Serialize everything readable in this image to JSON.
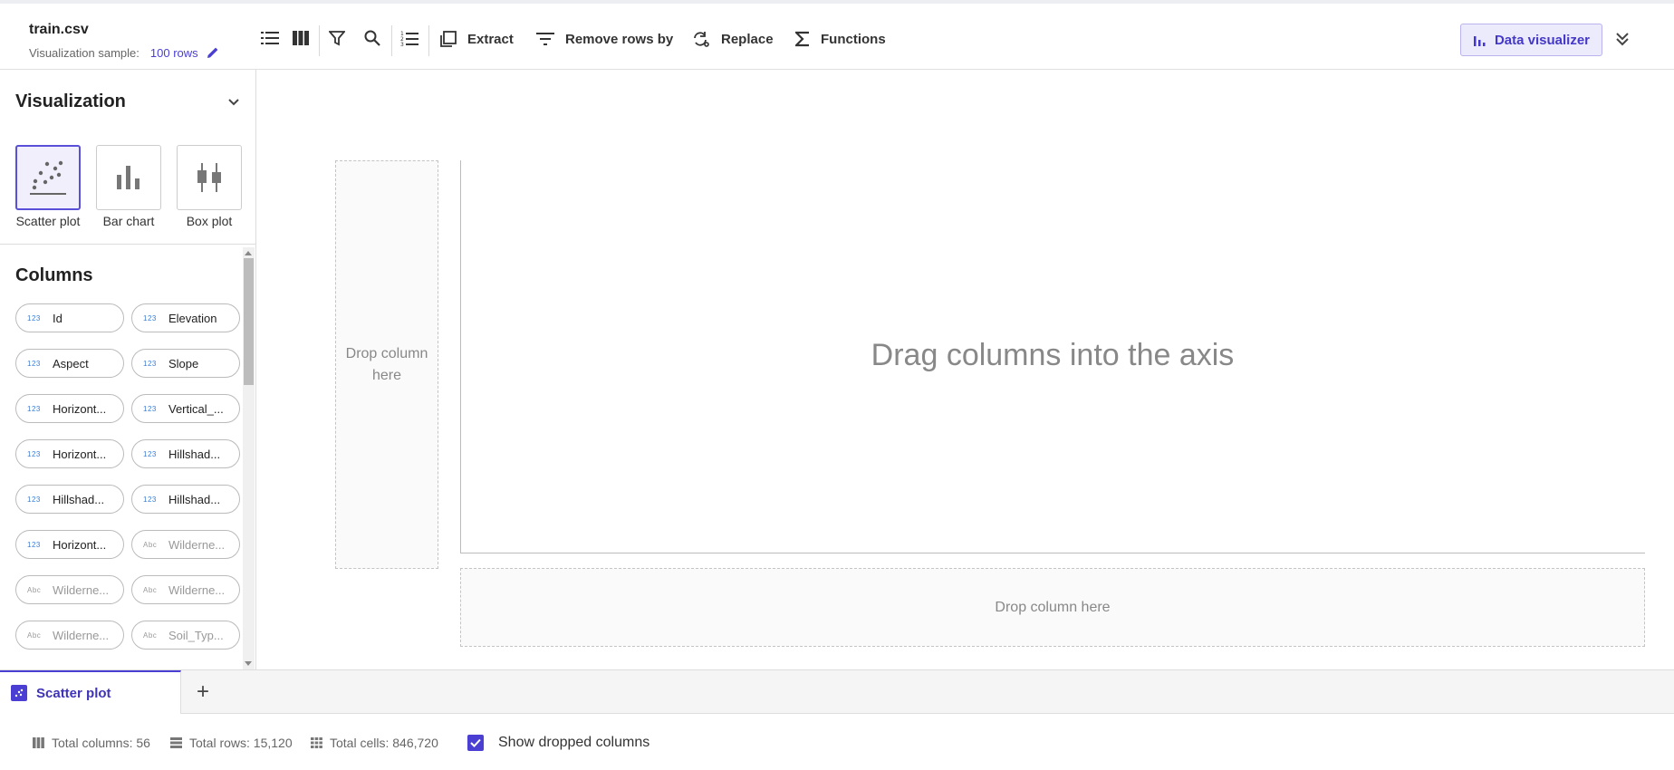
{
  "header": {
    "file_name": "train.csv",
    "sample_label": "Visualization sample:",
    "sample_rows": "100 rows",
    "toolbar": {
      "extract": "Extract",
      "remove_rows": "Remove rows by",
      "replace": "Replace",
      "functions": "Functions",
      "data_visualizer": "Data visualizer"
    }
  },
  "sidebar": {
    "visualization_title": "Visualization",
    "chart_types": [
      {
        "label": "Scatter plot",
        "icon": "scatter-plot-icon",
        "active": true
      },
      {
        "label": "Bar chart",
        "icon": "bar-chart-icon",
        "active": false
      },
      {
        "label": "Box plot",
        "icon": "box-plot-icon",
        "active": false
      }
    ],
    "columns_title": "Columns",
    "columns": [
      {
        "name": "Id",
        "type": "123"
      },
      {
        "name": "Elevation",
        "type": "123"
      },
      {
        "name": "Aspect",
        "type": "123"
      },
      {
        "name": "Slope",
        "type": "123"
      },
      {
        "name": "Horizont...",
        "type": "123"
      },
      {
        "name": "Vertical_...",
        "type": "123"
      },
      {
        "name": "Horizont...",
        "type": "123"
      },
      {
        "name": "Hillshad...",
        "type": "123"
      },
      {
        "name": "Hillshad...",
        "type": "123"
      },
      {
        "name": "Hillshad...",
        "type": "123"
      },
      {
        "name": "Horizont...",
        "type": "123"
      },
      {
        "name": "Wilderne...",
        "type": "Abc"
      },
      {
        "name": "Wilderne...",
        "type": "Abc"
      },
      {
        "name": "Wilderne...",
        "type": "Abc"
      },
      {
        "name": "Wilderne...",
        "type": "Abc"
      },
      {
        "name": "Soil_Typ...",
        "type": "Abc"
      }
    ]
  },
  "canvas": {
    "drop_y": "Drop column here",
    "empty_message": "Drag columns into the axis",
    "drop_x": "Drop column here"
  },
  "tabs": {
    "active_label": "Scatter plot",
    "add": "+"
  },
  "status": {
    "total_columns": "Total columns: 56",
    "total_rows": "Total rows: 15,120",
    "total_cells": "Total cells: 846,720",
    "show_dropped": "Show dropped columns"
  },
  "colors": {
    "accent": "#4b3fd3",
    "number_type": "#3a7dd8"
  }
}
